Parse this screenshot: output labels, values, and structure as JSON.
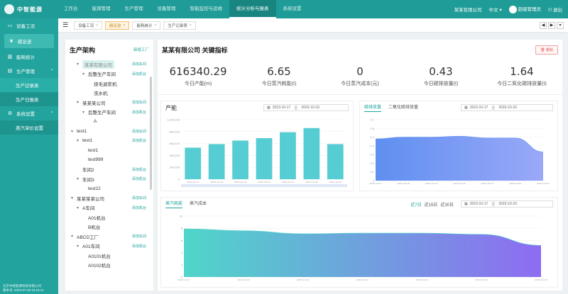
{
  "topbar": {
    "logo_text": "中智能源",
    "nav": [
      "工作台",
      "能源管理",
      "生产管理",
      "设备管理",
      "智能监控与运维",
      "统计分析与报表",
      "系统设置"
    ],
    "active_nav_index": 5,
    "right": {
      "company": "某某有限公司",
      "language": "中文",
      "user": "超级管理员",
      "logout": "退出"
    }
  },
  "sidebar": {
    "items": [
      {
        "label": "设备工况",
        "icon": "monitor-icon"
      },
      {
        "label": "碳足迹",
        "icon": "leaf-icon",
        "active": true
      },
      {
        "label": "能耗统计",
        "icon": "bar-chart-icon"
      },
      {
        "label": "生产管理",
        "icon": "factory-icon",
        "expanded": true
      },
      {
        "label": "生产记录表",
        "sub": true,
        "active": true
      },
      {
        "label": "生产日报表",
        "sub": true
      },
      {
        "label": "系统设置",
        "icon": "gear-icon",
        "expanded": true
      },
      {
        "label": "蒸汽单价设置",
        "sub": true
      }
    ],
    "footer_line1": "北京中智能源科技有限公司",
    "footer_line2": "版本号: 2023-07-28 16:19:11"
  },
  "tabs": [
    {
      "label": "设备工况"
    },
    {
      "label": "碳足迹",
      "active": true
    },
    {
      "label": "能耗统计"
    },
    {
      "label": "生产记录表"
    }
  ],
  "tree": {
    "title": "生产架构",
    "add_factory": "新增工厂",
    "rows": [
      {
        "label": "某某有限公司",
        "indent": 1,
        "toggle": "▾",
        "action": "添加车间",
        "highlight": true
      },
      {
        "label": "后整生产车间",
        "indent": 2,
        "toggle": "▾",
        "action": "添加机台"
      },
      {
        "label": "烧毛退浆机",
        "indent": 3,
        "toggle": "",
        "action": ""
      },
      {
        "label": "洗水机",
        "indent": 3,
        "toggle": "",
        "action": ""
      },
      {
        "label": "某某某公司",
        "indent": 1,
        "toggle": "▾",
        "action": "添加车间"
      },
      {
        "label": "后整生产车间",
        "indent": 2,
        "toggle": "▾",
        "action": "添加机台"
      },
      {
        "label": "A",
        "indent": 3,
        "toggle": "",
        "action": ""
      },
      {
        "label": "test1",
        "indent": 0,
        "toggle": "▾",
        "action": "添加车间"
      },
      {
        "label": "test1",
        "indent": 1,
        "toggle": "▾",
        "action": "添加机台"
      },
      {
        "label": "test1",
        "indent": 2,
        "toggle": "",
        "action": ""
      },
      {
        "label": "test999",
        "indent": 2,
        "toggle": "",
        "action": ""
      },
      {
        "label": "车间2",
        "indent": 1,
        "toggle": "",
        "action": "添加机台"
      },
      {
        "label": "车间3",
        "indent": 1,
        "toggle": "▾",
        "action": "添加机台"
      },
      {
        "label": "test22",
        "indent": 2,
        "toggle": "",
        "action": ""
      },
      {
        "label": "某某某某公司",
        "indent": 0,
        "toggle": "▾",
        "action": "添加车间"
      },
      {
        "label": "A车间",
        "indent": 1,
        "toggle": "▾",
        "action": "添加机台"
      },
      {
        "label": "A01机台",
        "indent": 2,
        "toggle": "",
        "action": ""
      },
      {
        "label": "B机台",
        "indent": 2,
        "toggle": "",
        "action": ""
      },
      {
        "label": "ABCD工厂",
        "indent": 0,
        "toggle": "▾",
        "action": "添加车间"
      },
      {
        "label": "A01车间",
        "indent": 1,
        "toggle": "▾",
        "action": "添加机台"
      },
      {
        "label": "A0101机台",
        "indent": 2,
        "toggle": "",
        "action": ""
      },
      {
        "label": "A0102机台",
        "indent": 2,
        "toggle": "",
        "action": ""
      }
    ]
  },
  "main": {
    "title": "某某有限公司 关键指标",
    "delete_label": "删除",
    "kpis": [
      {
        "value": "616340.29",
        "label": "今日产能(m)"
      },
      {
        "value": "6.65",
        "label": "今日蒸汽耗能(t)"
      },
      {
        "value": "0",
        "label": "今日蒸汽成本(元)"
      },
      {
        "value": "0.43",
        "label": "今日碳排放量(t)"
      },
      {
        "value": "1.64",
        "label": "今日二氧化碳排放量(t)"
      }
    ]
  },
  "capacity_card": {
    "title": "产能",
    "start": "2023-10-17",
    "to": "至",
    "end": "2023-10-23"
  },
  "carbon_card": {
    "tabs": [
      "碳排放量",
      "二氧化碳排放量"
    ],
    "active_tab": 0,
    "start": "2023-10-17",
    "to": "至",
    "end": "2023-10-23"
  },
  "steam_card": {
    "tabs": [
      "蒸汽耗能",
      "蒸汽成本"
    ],
    "active_tab": 0,
    "ranges": [
      "近7日",
      "近15日",
      "近30日"
    ],
    "active_range": 0,
    "start": "2023-10-17",
    "to": "至",
    "end": "2023-10-23"
  },
  "chart_data": [
    {
      "type": "bar",
      "title": "产能",
      "categories": [
        "2023-10-17",
        "2023-10-18",
        "2023-10-19",
        "2023-10-20",
        "2023-10-21",
        "2023-10-22",
        "2023-10-23"
      ],
      "values": [
        530000,
        590000,
        650000,
        690000,
        790000,
        860000,
        590000
      ],
      "yticks": [
        "0",
        "200,000",
        "400,000",
        "600,000",
        "800,000",
        "1,000,000"
      ],
      "ylim": [
        0,
        1000000
      ],
      "color": "#56cdd3"
    },
    {
      "type": "area",
      "title": "碳排放量",
      "x": [
        "2023-10-17",
        "2023-10-18",
        "2023-10-19",
        "2023-10-20",
        "2023-10-21",
        "2023-10-22",
        "2023-10-23"
      ],
      "values": [
        0.48,
        0.5,
        0.5,
        0.51,
        0.49,
        0.49,
        0.33
      ],
      "yticks": [
        "0",
        "0.1",
        "0.2",
        "0.3",
        "0.4",
        "0.5",
        "0.6",
        "0.7"
      ],
      "ylim": [
        0,
        0.7
      ],
      "colors": [
        "#5f8ff0",
        "#9aa8f8"
      ]
    },
    {
      "type": "area",
      "title": "蒸汽耗能",
      "x": [
        "2023-10-17",
        "2023-10-18",
        "2023-10-19",
        "2023-10-20",
        "2023-10-21",
        "2023-10-22",
        "2023-10-23"
      ],
      "values": [
        7.9,
        7.6,
        7.1,
        7.2,
        7.2,
        7.0,
        5.2
      ],
      "yticks": [
        "0",
        "2",
        "4",
        "6",
        "8",
        "10"
      ],
      "ylim": [
        0,
        10
      ],
      "colors": [
        "#4fd6c9",
        "#8e6cf2"
      ]
    }
  ]
}
